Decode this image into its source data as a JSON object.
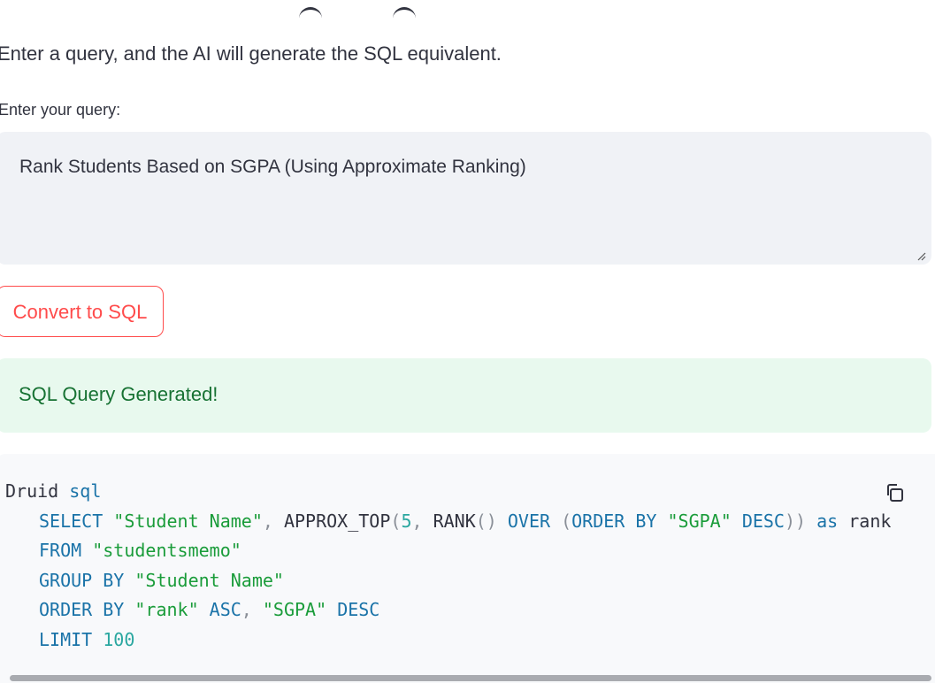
{
  "header": {
    "subtitle": "Enter a query, and the AI will generate the SQL equivalent."
  },
  "query_input": {
    "label": "Enter your query:",
    "value": "Rank Students Based on SGPA (Using Approximate Ranking)"
  },
  "convert_button": {
    "label": "Convert to SQL"
  },
  "success_alert": {
    "text": "SQL Query Generated!"
  },
  "code_block": {
    "lines": [
      [
        {
          "t": "Druid ",
          "c": "plain"
        },
        {
          "t": "sql",
          "c": "kw"
        }
      ],
      [
        {
          "t": "SELECT",
          "c": "kw"
        },
        {
          "t": " ",
          "c": "plain"
        },
        {
          "t": "\"Student Name\"",
          "c": "str"
        },
        {
          "t": ", ",
          "c": "pun"
        },
        {
          "t": "APPROX_TOP",
          "c": "plain"
        },
        {
          "t": "(",
          "c": "pun"
        },
        {
          "t": "5",
          "c": "num"
        },
        {
          "t": ", ",
          "c": "pun"
        },
        {
          "t": "RANK",
          "c": "plain"
        },
        {
          "t": "() ",
          "c": "pun"
        },
        {
          "t": "OVER",
          "c": "kw"
        },
        {
          "t": " (",
          "c": "pun"
        },
        {
          "t": "ORDER BY",
          "c": "kw"
        },
        {
          "t": " ",
          "c": "plain"
        },
        {
          "t": "\"SGPA\"",
          "c": "str"
        },
        {
          "t": " ",
          "c": "plain"
        },
        {
          "t": "DESC",
          "c": "kw"
        },
        {
          "t": ")) ",
          "c": "pun"
        },
        {
          "t": "as",
          "c": "kw"
        },
        {
          "t": " rank",
          "c": "plain"
        }
      ],
      [
        {
          "t": "FROM",
          "c": "kw"
        },
        {
          "t": " ",
          "c": "plain"
        },
        {
          "t": "\"studentsmemo\"",
          "c": "str"
        }
      ],
      [
        {
          "t": "GROUP BY",
          "c": "kw"
        },
        {
          "t": " ",
          "c": "plain"
        },
        {
          "t": "\"Student Name\"",
          "c": "str"
        }
      ],
      [
        {
          "t": "ORDER BY",
          "c": "kw"
        },
        {
          "t": " ",
          "c": "plain"
        },
        {
          "t": "\"rank\"",
          "c": "str"
        },
        {
          "t": " ",
          "c": "plain"
        },
        {
          "t": "ASC",
          "c": "kw"
        },
        {
          "t": ", ",
          "c": "pun"
        },
        {
          "t": "\"SGPA\"",
          "c": "str"
        },
        {
          "t": " ",
          "c": "plain"
        },
        {
          "t": "DESC",
          "c": "kw"
        }
      ],
      [
        {
          "t": "LIMIT",
          "c": "kw"
        },
        {
          "t": " ",
          "c": "plain"
        },
        {
          "t": "100",
          "c": "num"
        }
      ]
    ]
  },
  "icons": {
    "copy": "copy-icon",
    "resize": "resize-handle-icon"
  },
  "colors": {
    "accent": "#ff4b4b",
    "success_bg": "#e8f9ee",
    "success_text": "#177233",
    "input_bg": "#f0f2f6",
    "code_bg": "#f8f9fb"
  }
}
